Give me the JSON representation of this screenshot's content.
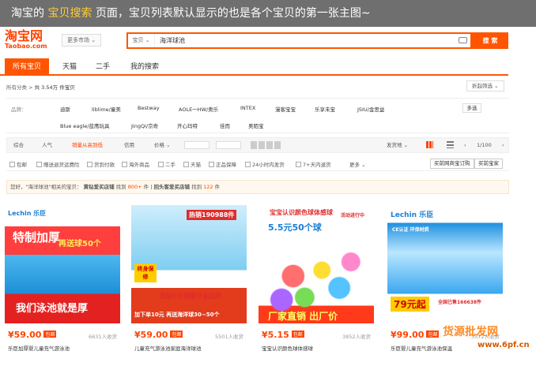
{
  "banner": {
    "part1": "淘宝的",
    "highlight": "宝贝搜索",
    "part2": "页面，宝贝列表默认显示的也是各个宝贝的第一张主图~"
  },
  "logo": {
    "cn": "淘宝网",
    "en": "Taobao.com"
  },
  "header": {
    "more_market": "更多市场 ⌄",
    "search_type": "宝贝 ⌄",
    "search_query": "海洋球池",
    "search_button": "搜 索"
  },
  "tabs": [
    "所有宝贝",
    "天猫",
    "二手",
    "我的搜索"
  ],
  "crumbs": {
    "label": "所有分类 >",
    "text": "共 3.54万 件宝贝"
  },
  "filter_label": "折起筛选 ⌄",
  "brands": {
    "label": "品牌：",
    "row1": [
      "迪斯",
      "liblime/童美",
      "Bestway",
      "AOLE一HW/奥乐",
      "INTEX",
      "漫客宝宝",
      "乐享未宝",
      "JSIU/金思益"
    ],
    "row2": [
      "Blue eagle/蓝鹰玩具",
      "JingQi/京奇",
      "开心玛特",
      "佳而",
      "奥陌宝"
    ],
    "more": "多选"
  },
  "sort": {
    "items": [
      "综合",
      "人气",
      "销量从高到低",
      "信用",
      "价格 ⌄"
    ],
    "location": "发货地 ⌄",
    "page": "1/100"
  },
  "options": {
    "items": [
      "包邮",
      "赠送退货运费险",
      "货到付款",
      "海外商品",
      "二手",
      "天猫",
      "正品保障",
      "24小时内发货",
      "7+天内退货"
    ],
    "more": "更多 ⌄",
    "btn1": "买前网商宝订购",
    "btn2": "买前宝家"
  },
  "notice": {
    "prefix": "您好，\"海洋球池\"相关的宝贝：",
    "bold1": "黄钻爱买店铺",
    "count1_pre": "找到",
    "count1": "800+",
    "count1_post": "件 |",
    "bold2": "回头客爱买店铺",
    "count2_pre": "找到",
    "count2": "122",
    "count2_post": "件"
  },
  "cards": [
    {
      "price": "¥59.00",
      "tag": "包邮",
      "sales": "6631人收货",
      "title": "乐臣加厚婴儿童充气游泳池",
      "art_brand": "Lechin 乐臣",
      "art_main": "特制加厚",
      "art_sub": "再送球50个",
      "art_bottom": "我们泳池就是厚"
    },
    {
      "price": "¥59.00",
      "tag": "包邮",
      "sales": "5501人收货",
      "title": "儿童充气游泳池家庭海洋球池",
      "art_brand": "热销190988件",
      "art_main": "终身保修",
      "art_sub": "连续5年销量夺金品牌",
      "art_bottom": "加下单10元 再送海洋球30~50个"
    },
    {
      "price": "¥5.15",
      "tag": "包邮",
      "sales": "3852人收货",
      "title": "宝宝认识颜色球体感球",
      "art_brand": "宝宝认识颜色球体感球",
      "art_main": "5.5元50个球",
      "art_sub": "活动进行中",
      "art_bottom": "厂家直销 出厂价"
    },
    {
      "price": "¥99.00",
      "tag": "包邮",
      "sales": "3372人收货",
      "title": "乐臣婴儿童充气游泳池保温",
      "art_brand": "Lechin 乐臣",
      "art_main": "CE认证 环保材质",
      "art_sub": "全国已售166638件",
      "art_bottom": "79元起"
    }
  ],
  "watermark": {
    "line1": "货源批发网",
    "line2": "www.6pf.cn"
  },
  "colors": {
    "accent": "#ff5500",
    "price": "#ff4400",
    "banner_bg": "#6f6f6f",
    "highlight": "#ffcc33"
  }
}
